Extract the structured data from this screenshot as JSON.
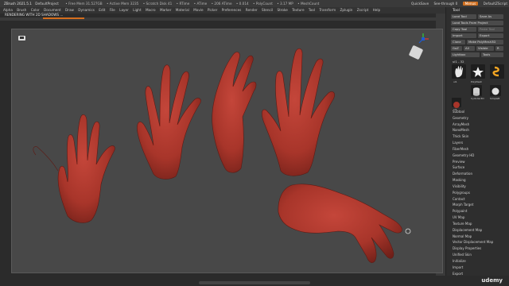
{
  "titlebar": {
    "title": "ZBrush 2021.5.1",
    "project": "DefaultProject",
    "stats": [
      "• Free Mem 31.527GB",
      "• Active Mem 3235",
      "• Scratch Disk 41",
      "• RTime",
      "• ATime",
      "• 206 ATime",
      "• 0.014",
      "• PolyCount",
      "• 3.17 MP",
      "• MeshCount"
    ],
    "quicksave": "QuickSave",
    "seethrough": "See-through 0",
    "menus_btn": "Menus",
    "script": "DefaultZScript"
  },
  "menubar": {
    "items": [
      "Alpha",
      "Brush",
      "Color",
      "Document",
      "Draw",
      "Dynamics",
      "Edit",
      "File",
      "Layer",
      "Light",
      "Macro",
      "Marker",
      "Material",
      "Movie",
      "Picker",
      "Preferences",
      "Render",
      "Stencil",
      "Stroke",
      "Texture",
      "Tool",
      "Transform",
      "Zplugin",
      "Zscript",
      "Help"
    ]
  },
  "notification": "RENDERING WITH 2D SHADOWS ...",
  "panel": {
    "tool_title": "Tool",
    "buttons": [
      {
        "label": "Load Tool"
      },
      {
        "label": "Save As"
      },
      {
        "label": "Load Tools From Project"
      },
      {
        "label": "Copy Tool"
      },
      {
        "label": "Paste Tool"
      },
      {
        "label": "Import"
      },
      {
        "label": "Export"
      },
      {
        "label": "Clone"
      },
      {
        "label": "Make PolyMesh3D"
      },
      {
        "label": "GoZ"
      },
      {
        "label": "All"
      },
      {
        "label": "Visible"
      },
      {
        "label": "R"
      },
      {
        "label": "Lightbox"
      },
      {
        "label": "Tools"
      }
    ],
    "current_tool": "ul1 - 32",
    "thumbs": [
      {
        "caption": "ul1"
      },
      {
        "caption": "PolyMesh"
      },
      {
        "caption": "Cylinder3D"
      },
      {
        "caption": "SimpleB"
      },
      {
        "caption": "ul1"
      }
    ],
    "menu_items": [
      "Subtool",
      "Geometry",
      "ArrayMesh",
      "NanoMesh",
      "Thick Skin",
      "Layers",
      "FiberMesh",
      "Geometry HD",
      "Preview",
      "Surface",
      "Deformation",
      "Masking",
      "Visibility",
      "Polygroups",
      "Contact",
      "Morph Target",
      "Polypaint",
      "UV Map",
      "Texture Map",
      "Displacement Map",
      "Normal Map",
      "Vector Displacement Map",
      "Display Properties",
      "Unified Skin",
      "Initialize",
      "Import",
      "Export"
    ]
  },
  "watermark": "udemy",
  "colors": {
    "skin": "#a8352a",
    "skin_dark": "#6e1f18",
    "accent": "#d46e1e",
    "viewport": "#484848"
  }
}
